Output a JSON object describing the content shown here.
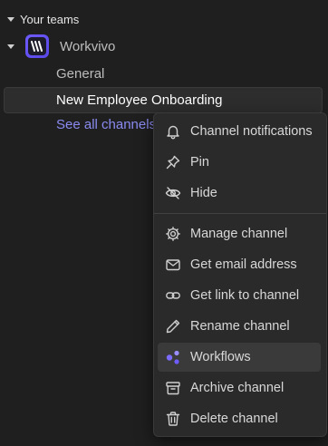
{
  "sidebar": {
    "section_title": "Your teams",
    "team": {
      "name": "Workvivo",
      "logo": "workvivo-logo-icon"
    },
    "channels": [
      {
        "label": "General",
        "selected": false
      },
      {
        "label": "New Employee Onboarding",
        "selected": true
      }
    ],
    "see_all_label": "See all channels"
  },
  "context_menu": {
    "groups": [
      [
        {
          "label": "Channel notifications",
          "icon": "bell-icon"
        },
        {
          "label": "Pin",
          "icon": "pin-icon"
        },
        {
          "label": "Hide",
          "icon": "eye-off-icon"
        }
      ],
      [
        {
          "label": "Manage channel",
          "icon": "gear-icon"
        },
        {
          "label": "Get email address",
          "icon": "envelope-icon"
        },
        {
          "label": "Get link to channel",
          "icon": "link-icon"
        },
        {
          "label": "Rename channel",
          "icon": "pencil-icon"
        },
        {
          "label": "Workflows",
          "icon": "workflows-icon",
          "highlighted": true
        },
        {
          "label": "Archive channel",
          "icon": "archive-icon"
        },
        {
          "label": "Delete channel",
          "icon": "trash-icon"
        }
      ]
    ]
  },
  "colors": {
    "background": "#1f1f1f",
    "menu_background": "#2a2a2a",
    "link": "#8a8bf0",
    "brand": "#6f5cff",
    "workflows_icon": "#7b6cff"
  }
}
